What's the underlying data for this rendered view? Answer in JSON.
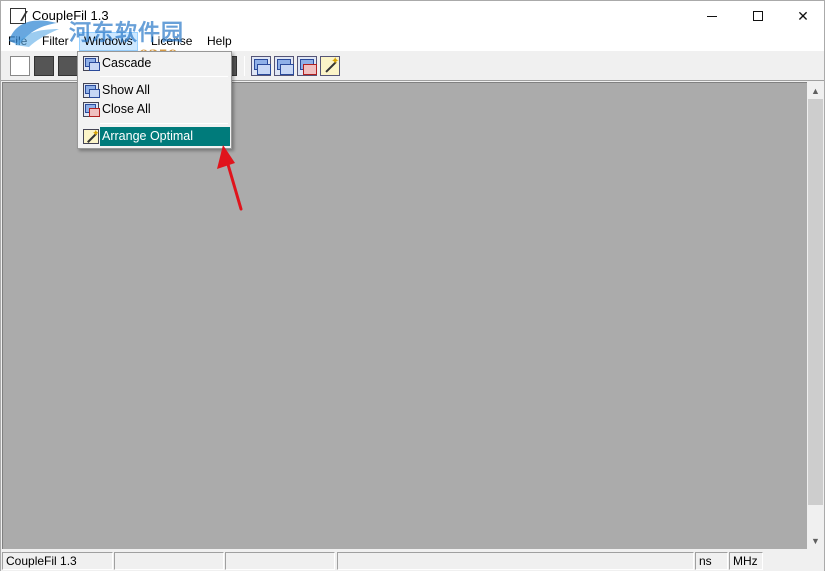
{
  "window": {
    "title": "CoupleFil 1.3"
  },
  "watermark": {
    "text_cn": "河东软件园",
    "url": "www.pc0359.cn"
  },
  "menubar": {
    "items": [
      {
        "label": "File"
      },
      {
        "label": "Filter"
      },
      {
        "label": "Windows"
      },
      {
        "label": "License"
      },
      {
        "label": "Help"
      }
    ]
  },
  "windows_menu": {
    "items": [
      {
        "label": "Cascade",
        "icon": "cascade-icon"
      },
      {
        "label": "Show All",
        "icon": "show-all-icon"
      },
      {
        "label": "Close All",
        "icon": "close-all-icon"
      },
      {
        "label": "Arrange Optimal",
        "icon": "magic-wand-icon",
        "highlighted": true
      }
    ]
  },
  "statusbar": {
    "app": "CoupleFil 1.3",
    "pane2": "",
    "pane3": "",
    "pane4": "",
    "unit_time": "ns",
    "unit_freq": "MHz"
  },
  "colors": {
    "highlight": "#007b7b",
    "client_bg": "#ababab",
    "annotation_arrow": "#e0141c"
  }
}
